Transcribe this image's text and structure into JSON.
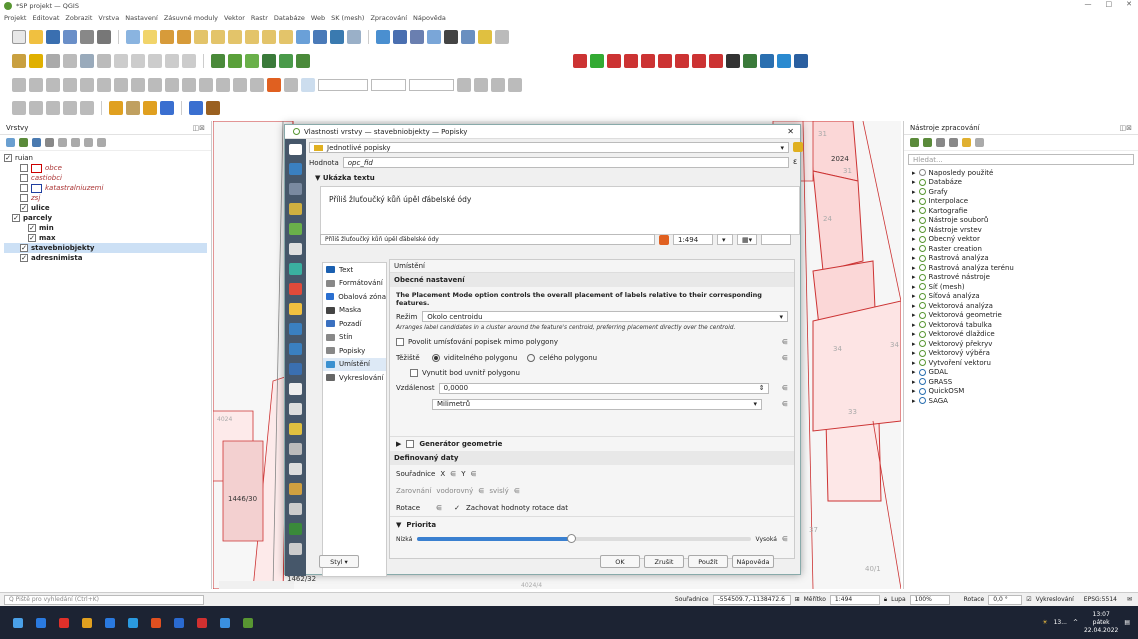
{
  "app": {
    "title": "*SP projekt — QGIS"
  },
  "window_controls": {
    "minimize": "—",
    "maximize": "□",
    "close": "✕"
  },
  "menu": [
    "Projekt",
    "Editovat",
    "Zobrazit",
    "Vrstva",
    "Nastavení",
    "Zásuvné moduly",
    "Vektor",
    "Rastr",
    "Databáze",
    "Web",
    "SK (mesh)",
    "Zpracování",
    "Nápověda"
  ],
  "layers_panel": {
    "title": "Vrstvy",
    "items": [
      {
        "label": "ruian",
        "indent": 0,
        "checked": true,
        "bold": false,
        "italic": false
      },
      {
        "label": "obce",
        "indent": 2,
        "checked": false,
        "bold": false,
        "italic": true
      },
      {
        "label": "castiobci",
        "indent": 2,
        "checked": false,
        "bold": false,
        "italic": true
      },
      {
        "label": "katastralniuzemi",
        "indent": 2,
        "checked": false,
        "bold": false,
        "italic": true
      },
      {
        "label": "zsj",
        "indent": 2,
        "checked": false,
        "bold": false,
        "italic": true
      },
      {
        "label": "ulice",
        "indent": 2,
        "checked": true,
        "bold": true,
        "italic": false
      },
      {
        "label": "parcely",
        "indent": 1,
        "checked": true,
        "bold": true,
        "italic": false
      },
      {
        "label": "min",
        "indent": 3,
        "checked": true,
        "bold": true,
        "italic": false
      },
      {
        "label": "max",
        "indent": 3,
        "checked": true,
        "bold": true,
        "italic": false
      },
      {
        "label": "stavebniobjekty",
        "indent": 2,
        "checked": true,
        "bold": true,
        "italic": false
      },
      {
        "label": "adresnimista",
        "indent": 2,
        "checked": true,
        "bold": true,
        "italic": false
      }
    ]
  },
  "map": {
    "labels": [
      "31",
      "2024",
      "31",
      "4024",
      "1446/30",
      "1462/32",
      "24",
      "33",
      "34",
      "34",
      "37",
      "40/1",
      "4024/4"
    ]
  },
  "dialog": {
    "title": "Vlastnosti vrstvy — stavebniobjekty — Popisky",
    "mode": "Jednotlivé popisky",
    "value_label": "Hodnota",
    "value": "opc_fid",
    "preview_header": "Ukázka textu",
    "preview_text": "Příliš žluťoučký kůň úpěl ďábelské ódy",
    "preview_field": "Příliš žluťoučký kůň úpěl ďábelské ódy",
    "scale": "1:494",
    "nav": [
      {
        "label": "Text",
        "active": false
      },
      {
        "label": "Formátování",
        "active": false
      },
      {
        "label": "Obalová zóna",
        "active": false
      },
      {
        "label": "Maska",
        "active": false
      },
      {
        "label": "Pozadí",
        "active": false
      },
      {
        "label": "Stín",
        "active": false
      },
      {
        "label": "Popisky",
        "active": false
      },
      {
        "label": "Umístění",
        "active": true
      },
      {
        "label": "Vykreslování",
        "active": false
      }
    ],
    "section": "Umístění",
    "general": "Obecné nastavení",
    "placement_tip": "The Placement Mode option controls the overall placement of labels relative to their corresponding features.",
    "mode_label": "Režim",
    "mode_value": "Okolo centroidu",
    "mode_desc": "Arranges label candidates in a cluster around the feature's centroid, preferring placement directly over the centroid.",
    "allow_outside": "Povolit umísťování popisek mimo polygony",
    "centroid_label": "Těžiště",
    "centroid_visible": "viditelného polygonu",
    "centroid_whole": "celého polygonu",
    "force_inside": "Vynutit bod uvnitř polygonu",
    "distance_label": "Vzdálenost",
    "distance_value": "0,0000",
    "unit": "Milimetrů",
    "geometry_gen": "Generátor geometrie",
    "defined_data": "Definovaný daty",
    "coord_label": "Souřadnice",
    "coord_x": "X",
    "coord_y": "Y",
    "align_label": "Zarovnání",
    "align_h": "vodorovný",
    "align_v": "svislý",
    "rotation_label": "Rotace",
    "keep_rotation": "Zachovat hodnoty rotace dat",
    "priority": "Priorita",
    "low": "Nízká",
    "high": "Vysoká",
    "priority_level": 0.46,
    "style_btn": "Styl",
    "ok": "OK",
    "cancel": "Zrušit",
    "apply": "Použít",
    "help": "Nápověda"
  },
  "toolbox": {
    "title": "Nástroje zpracování",
    "search_placeholder": "Hledat...",
    "items": [
      "Naposledy použité",
      "Databáze",
      "Grafy",
      "Interpolace",
      "Kartografie",
      "Nástroje souborů",
      "Nástroje vrstev",
      "Obecný vektor",
      "Raster creation",
      "Rastrová analýza",
      "Rastrová analýza terénu",
      "Rastrové nástroje",
      "Síť (mesh)",
      "Síťová analýza",
      "Vektorová analýza",
      "Vektorová geometrie",
      "Vektorová tabulka",
      "Vektorové dlaždice",
      "Vektorový překryv",
      "Vektorový výběra",
      "Vytvoření vektoru",
      "GDAL",
      "GRASS",
      "QuickOSM",
      "SAGA"
    ]
  },
  "status": {
    "locator": "Q  Piště pro vyhledání (Ctrl+K)",
    "coord_label": "Souřadnice",
    "coord": "-554509.7,-1138472.6",
    "scale_label": "Měřítko",
    "scale": "1:494",
    "mag_label": "Lupa",
    "mag": "100%",
    "rotation_label": "Rotace",
    "rotation": "0,0 °",
    "render": "Vykreslování",
    "crs": "EPSG:5514"
  },
  "taskbar": {
    "weather": "13...",
    "time": "13:07",
    "day": "pátek",
    "date": "22.04.2022"
  }
}
